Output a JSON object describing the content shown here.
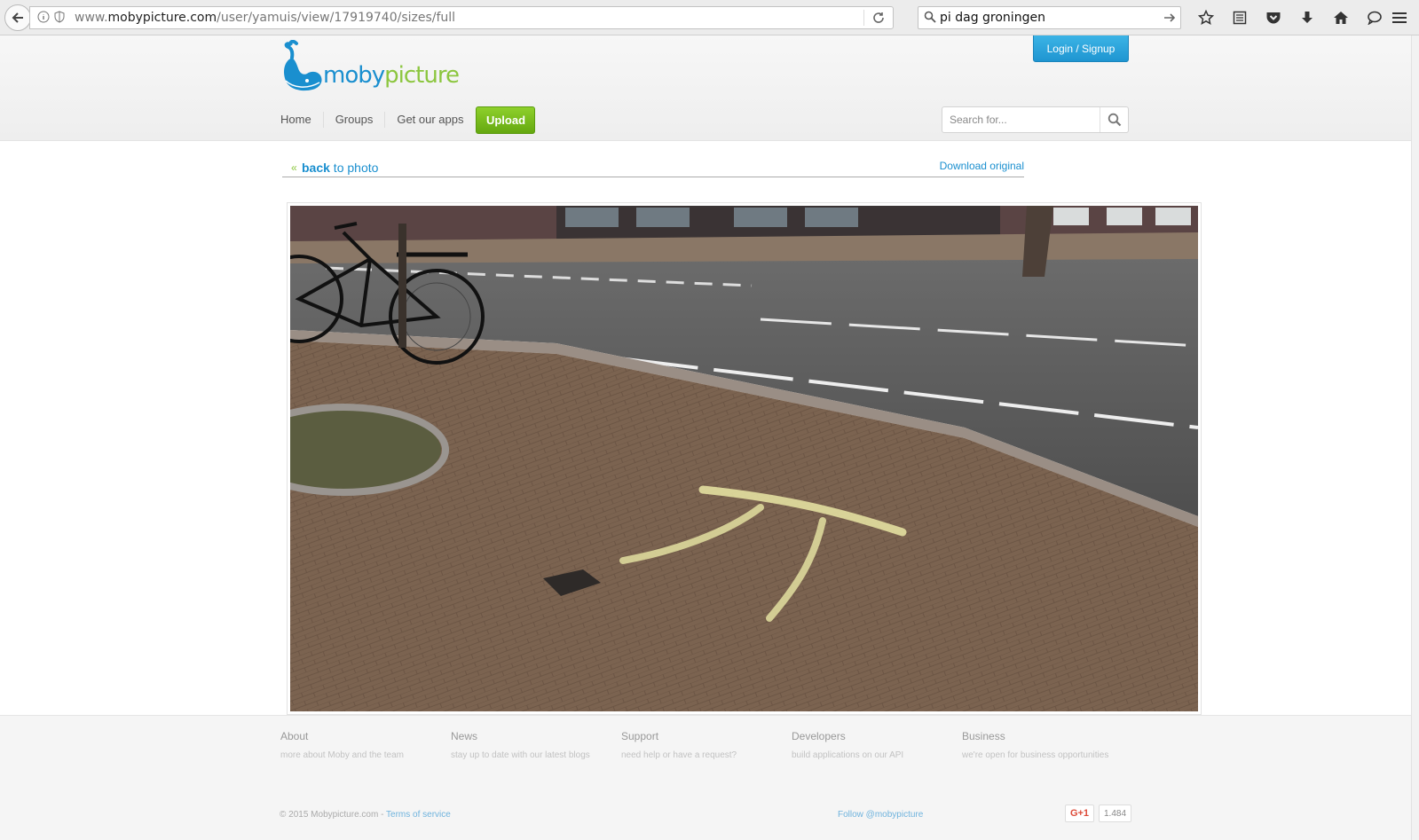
{
  "browser": {
    "url_prefix": "www.",
    "url_domain": "mobypicture.com",
    "url_path": "/user/yamuis/view/17919740/sizes/full",
    "search_query": "pi dag groningen",
    "toolbar_icons": [
      "star-icon",
      "reading-list-icon",
      "pocket-icon",
      "download-icon",
      "home-icon",
      "chat-icon"
    ]
  },
  "site": {
    "logo_moby": "moby",
    "logo_picture": "picture",
    "login_label": "Login / Signup",
    "nav": [
      "Home",
      "Groups",
      "Get our apps"
    ],
    "upload_label": "Upload",
    "search_placeholder": "Search for..."
  },
  "photo_page": {
    "raquo": "«",
    "back_bold": "back",
    "back_rest": " to photo",
    "download_label": "Download original"
  },
  "footer": {
    "columns": [
      {
        "title": "About",
        "sub": "more about Moby and the team"
      },
      {
        "title": "News",
        "sub": "stay up to date with our latest blogs"
      },
      {
        "title": "Support",
        "sub": "need help or have a request?"
      },
      {
        "title": "Developers",
        "sub": "build applications on our API"
      },
      {
        "title": "Business",
        "sub": "we're open for business opportunities"
      }
    ],
    "copyright": "© 2015 Mobypicture.com - ",
    "terms": "Terms of service",
    "follow": "Follow @mobypicture",
    "gplus_label": "G+1",
    "gplus_count": "1.484"
  },
  "colors": {
    "brand_blue": "#1a8fcf",
    "brand_green": "#8cc63f"
  }
}
